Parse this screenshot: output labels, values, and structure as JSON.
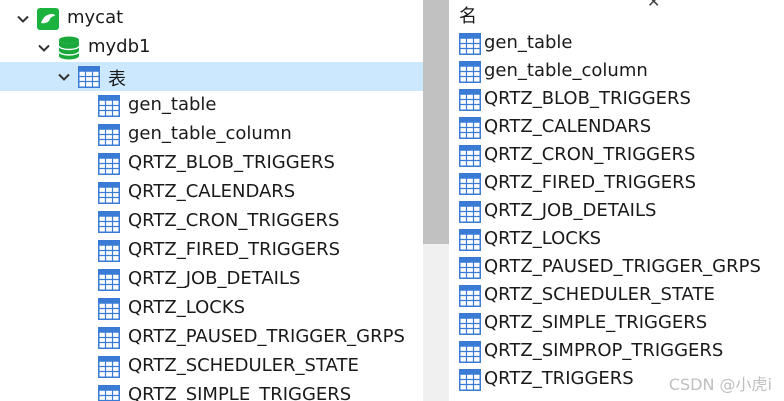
{
  "tree": {
    "connection": {
      "label": "mycat",
      "icon": "mysql-connection-icon"
    },
    "database": {
      "label": "mydb1",
      "icon": "database-icon"
    },
    "tables_folder": {
      "label": "表",
      "icon": "table-icon"
    },
    "tables": [
      "gen_table",
      "gen_table_column",
      "QRTZ_BLOB_TRIGGERS",
      "QRTZ_CALENDARS",
      "QRTZ_CRON_TRIGGERS",
      "QRTZ_FIRED_TRIGGERS",
      "QRTZ_JOB_DETAILS",
      "QRTZ_LOCKS",
      "QRTZ_PAUSED_TRIGGER_GRPS",
      "QRTZ_SCHEDULER_STATE",
      "QRTZ_SIMPLE_TRIGGERS"
    ]
  },
  "object_list": {
    "header": "名",
    "items": [
      "gen_table",
      "gen_table_column",
      "QRTZ_BLOB_TRIGGERS",
      "QRTZ_CALENDARS",
      "QRTZ_CRON_TRIGGERS",
      "QRTZ_FIRED_TRIGGERS",
      "QRTZ_JOB_DETAILS",
      "QRTZ_LOCKS",
      "QRTZ_PAUSED_TRIGGER_GRPS",
      "QRTZ_SCHEDULER_STATE",
      "QRTZ_SIMPLE_TRIGGERS",
      "QRTZ_SIMPROP_TRIGGERS",
      "QRTZ_TRIGGERS"
    ]
  },
  "watermark": "CSDN @小虎i",
  "colors": {
    "selection": "#cce8ff",
    "table_icon_header": "#3a7bd5",
    "connection_green": "#1bb33e",
    "database_green": "#1aa83a"
  }
}
